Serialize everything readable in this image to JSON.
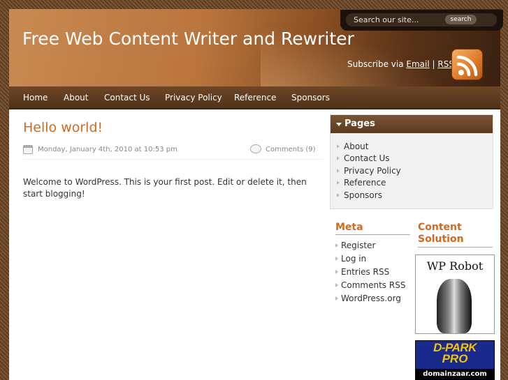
{
  "header": {
    "site_title": "Free Web Content Writer and Rewriter",
    "search_placeholder": "Search our site...",
    "search_button": "search",
    "subscribe_prefix": "Subscribe via",
    "subscribe_email": "Email",
    "subscribe_sep": "|",
    "subscribe_rss": "RSS"
  },
  "nav": {
    "items": [
      {
        "label": "Home"
      },
      {
        "label": "About"
      },
      {
        "label": "Contact Us"
      },
      {
        "label": "Privacy Policy"
      },
      {
        "label": "Reference"
      },
      {
        "label": "Sponsors"
      }
    ]
  },
  "post": {
    "title": "Hello world!",
    "date": "Monday, January 4th, 2010 at 10:53 pm",
    "comments": "Comments (9)",
    "body": "Welcome to WordPress. This is your first post. Edit or delete it, then start blogging!"
  },
  "sidebar": {
    "pages_title": "Pages",
    "pages": [
      {
        "label": "About"
      },
      {
        "label": "Contact Us"
      },
      {
        "label": "Privacy Policy"
      },
      {
        "label": "Reference"
      },
      {
        "label": "Sponsors"
      }
    ],
    "meta_title": "Meta",
    "meta": [
      {
        "label": "Register"
      },
      {
        "label": "Log in"
      },
      {
        "label": "Entries RSS"
      },
      {
        "label": "Comments RSS"
      },
      {
        "label": "WordPress.org"
      }
    ],
    "content_solution_title": "Content Solution",
    "ads": {
      "wp_robot": "WP Robot",
      "dpark_line1": "D-PARK",
      "dpark_line2": "PRO",
      "dpark_line3": "domainzaar.com"
    }
  },
  "colors": {
    "accent": "#d2691e",
    "nav_bg": "#5a3a1e",
    "header_bg": "#b9743c"
  }
}
